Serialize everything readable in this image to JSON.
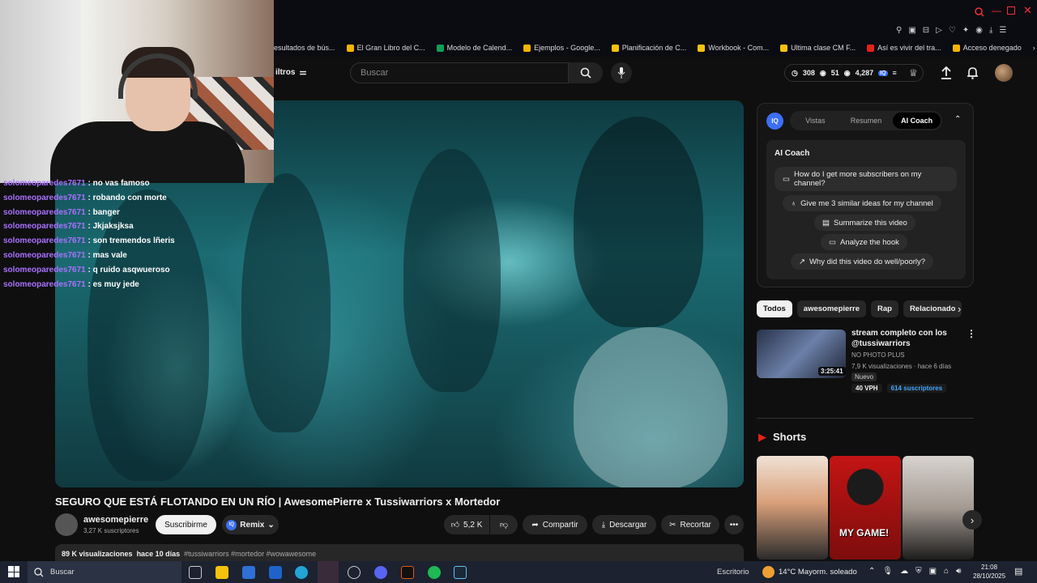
{
  "browser": {
    "bookmarks": [
      {
        "label": "esultados de bús...",
        "color": "#4a8cf0"
      },
      {
        "label": "El Gran Libro del C...",
        "color": "#f4b400"
      },
      {
        "label": "Modelo de Calend...",
        "color": "#0f9d58"
      },
      {
        "label": "Ejemplos - Google...",
        "color": "#f4b400"
      },
      {
        "label": "Planificación de C...",
        "color": "#f4c20d"
      },
      {
        "label": "Workbook - Com...",
        "color": "#f4c20d"
      },
      {
        "label": "Ultima clase CM F...",
        "color": "#f4c20d"
      },
      {
        "label": "Así es vivir del tra...",
        "color": "#e62117"
      },
      {
        "label": "Acceso denegado",
        "color": "#f4b400"
      }
    ]
  },
  "header": {
    "filters_label": "iltros",
    "search_placeholder": "Buscar",
    "stats": {
      "a": "308",
      "b": "51",
      "c": "4,287"
    }
  },
  "chat": [
    {
      "user": "solomeoparedes7671",
      "msg": ": no vas famoso"
    },
    {
      "user": "solomeoparedes7671",
      "msg": ": robando con morte"
    },
    {
      "user": "solomeoparedes7671",
      "msg": ": banger"
    },
    {
      "user": "solomeoparedes7671",
      "msg": ": Jkjaksjksa"
    },
    {
      "user": "solomeoparedes7671",
      "msg": ": son tremendos lñeris"
    },
    {
      "user": "solomeoparedes7671",
      "msg": ": mas vale"
    },
    {
      "user": "solomeoparedes7671",
      "msg": ": q ruido asqwueroso"
    },
    {
      "user": "solomeoparedes7671",
      "msg": ": es muy jede"
    }
  ],
  "video": {
    "title": "SEGURO QUE ESTÁ FLOTANDO EN UN RÍO | AwesomePierre x Tussiwarriors x Mortedor",
    "channel": "awesomepierre",
    "subscribers": "3,27 K suscriptores",
    "subscribe_label": "Suscribirme",
    "remix_label": "Remix",
    "likes": "5,2 K",
    "share_label": "Compartir",
    "download_label": "Descargar",
    "clip_label": "Recortar",
    "views": "89 K visualizaciones",
    "age": "hace 10 días",
    "tags": "#tussiwarriors #mortedor #wowawesome"
  },
  "iq": {
    "logo": "IQ",
    "tabs": [
      "Vistas",
      "Resumen",
      "AI Coach"
    ],
    "coach_title": "AI Coach",
    "questions": [
      "How do I get more subscribers on my channel?",
      "Give me 3 similar ideas for my channel",
      "Summarize this video",
      "Analyze the hook",
      "Why did this video do well/poorly?"
    ]
  },
  "chips": [
    "Todos",
    "awesomepierre",
    "Rap",
    "Relacionado"
  ],
  "recommended": {
    "title": "stream completo con los @tussiwarriors",
    "channel": "NO PHOTO PLUS",
    "meta": "7,9 K visualizaciones · hace 6 días",
    "badge": "Nuevo",
    "duration": "3:25:41",
    "vph": "40 VPH",
    "subs": "614 suscriptores"
  },
  "shorts": {
    "title": "Shorts",
    "second_caption": "MY GAME!"
  },
  "taskbar": {
    "search": "Buscar",
    "desktop_label": "Escritorio",
    "weather": "14°C  Mayorm. soleado",
    "time": "21:08",
    "date": "28/10/2025"
  }
}
